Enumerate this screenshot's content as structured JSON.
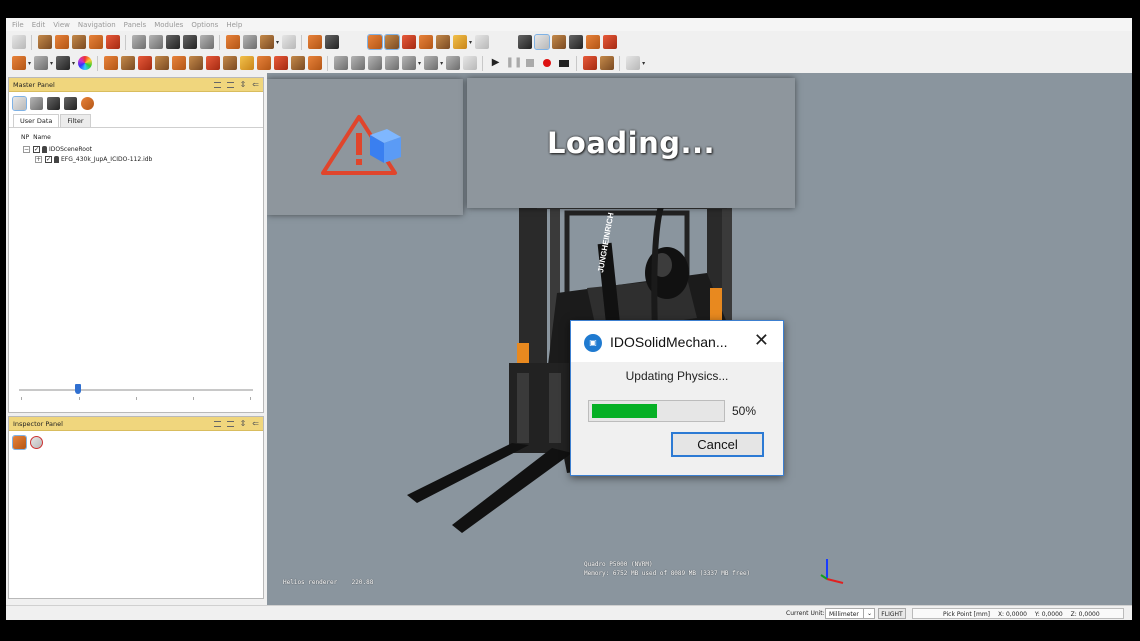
{
  "menu": [
    "File",
    "Edit",
    "View",
    "Navigation",
    "Panels",
    "Modules",
    "Options",
    "Help"
  ],
  "master_panel": {
    "title": "Master Panel",
    "tabs": [
      "User Data",
      "Filter"
    ],
    "tree_header": [
      "NP",
      "Name"
    ],
    "tree": [
      {
        "label": "IDOSceneRoot",
        "checked": "✓",
        "expander": "−"
      },
      {
        "label": "EFG_430k_JupA_ICIDO-112.idb",
        "checked": "✓",
        "expander": "+"
      }
    ],
    "slider_value": 0.25
  },
  "inspector_panel": {
    "title": "Inspector Panel"
  },
  "viewport": {
    "loading_text": "Loading...",
    "renderer_text": "Helios renderer    220.88",
    "gpu_text": "Quadro P5000 (NVRM)",
    "memory_text": "Memory: 6752 MB used of 8089 MB (3337 MB free)"
  },
  "dialog": {
    "title": "IDOSolidMechan...",
    "close": "✕",
    "message": "Updating Physics...",
    "progress_value": 50,
    "progress_label": "50%",
    "cancel_label": "Cancel",
    "app_icon_glyph": "▣"
  },
  "statusbar": {
    "unit_label": "Current Unit:",
    "unit_value": "Millimeter",
    "unit_arrow": "⌄",
    "flight_label": "FLIGHT",
    "pick_label": "Pick Point [mm]",
    "x": "X: 0,0000",
    "y": "Y: 0,0000",
    "z": "Z: 0,0000"
  },
  "colors": {
    "panel_header": "#f0d67d",
    "viewport_bg": "#8a959e",
    "progress_fill": "#06b025",
    "accent_blue": "#2c7ad4",
    "warning_red": "#e0452c"
  }
}
